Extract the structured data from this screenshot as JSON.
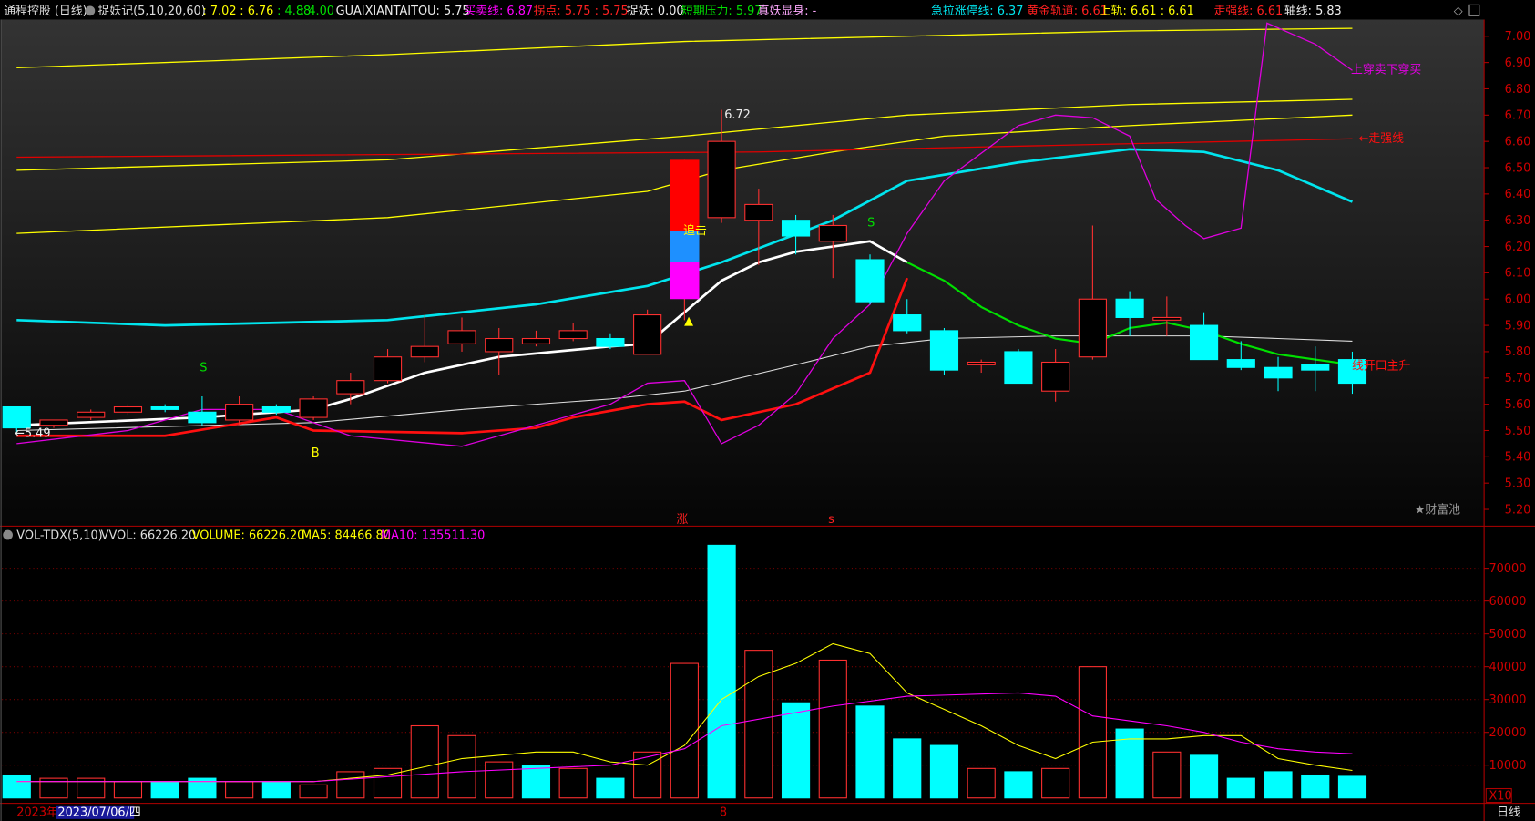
{
  "header": {
    "title": "通程控股 (日线)",
    "indicator": "捉妖记(5,10,20,60)",
    "v1": ": 7.02",
    "v2": ": 6.76",
    "v3": ": 4.88",
    "v4": ": 4.00",
    "guaixian": "GUAIXIANTAITOU: 5.75",
    "maimai": "买卖线: 6.87",
    "guaidian": "拐点: 5.75 : 5.75",
    "zhuoyao": "捉妖: 0.00",
    "duanqi": "短期压力: 5.97",
    "zhenyao": "真妖显身: -",
    "jila": "急拉涨停线: 6.37",
    "huangjin": "黄金轨道: 6.61",
    "shanggui": "上轨: 6.61 : 6.61",
    "zouqiang": "走强线: 6.61",
    "zhouxian": "轴线: 5.83"
  },
  "colors": {
    "up": "#ff3030",
    "down": "#00ffff",
    "axis": "#b00000",
    "yellow": "#ffff00",
    "magenta": "#ff00ff",
    "green": "#00e000"
  },
  "annotations": {
    "high_label": "6.72",
    "low_label": "←5.49",
    "zhuiji": "追击",
    "s1": "S",
    "s2": "S",
    "b1": "B",
    "zhang": "涨",
    "s_mark": "s",
    "shangchuan": "上穿卖下穿买",
    "zouqiangxian": "←走强线",
    "kaikou": "线开口主升",
    "caifuchi": "★财富池",
    "triangle": "▲"
  },
  "volume_header": {
    "name": "VOL-TDX(5,10)",
    "vvol": "VVOL: 66226.20",
    "volume": "VOLUME: 66226.20",
    "ma5": "MA5: 84466.80",
    "ma10": "MA10: 135511.30"
  },
  "footer": {
    "year": "2023年",
    "date": "2023/07/06/四",
    "month_mark": "8",
    "period": "日线",
    "multiplier": "X10"
  },
  "chart_data": {
    "type": "candlestick",
    "price_ticks": [
      "7.00",
      "6.90",
      "6.80",
      "6.70",
      "6.60",
      "6.50",
      "6.40",
      "6.30",
      "6.20",
      "6.10",
      "6.00",
      "5.90",
      "5.80",
      "5.70",
      "5.60",
      "5.50",
      "5.40",
      "5.30",
      "5.20"
    ],
    "ylim": [
      5.13,
      7.05
    ],
    "volume_ticks": [
      "70000",
      "60000",
      "50000",
      "40000",
      "30000",
      "20000",
      "10000"
    ],
    "candles": [
      [
        5.59,
        5.59,
        5.49,
        5.51
      ],
      [
        5.52,
        5.54,
        5.51,
        5.54
      ],
      [
        5.55,
        5.58,
        5.54,
        5.57
      ],
      [
        5.57,
        5.6,
        5.56,
        5.59
      ],
      [
        5.59,
        5.6,
        5.57,
        5.58
      ],
      [
        5.57,
        5.63,
        5.52,
        5.53
      ],
      [
        5.54,
        5.63,
        5.52,
        5.6
      ],
      [
        5.59,
        5.6,
        5.56,
        5.57
      ],
      [
        5.55,
        5.63,
        5.54,
        5.62
      ],
      [
        5.64,
        5.72,
        5.6,
        5.69
      ],
      [
        5.69,
        5.81,
        5.68,
        5.78
      ],
      [
        5.78,
        5.94,
        5.76,
        5.82
      ],
      [
        5.83,
        5.93,
        5.8,
        5.88
      ],
      [
        5.8,
        5.89,
        5.71,
        5.85
      ],
      [
        5.83,
        5.88,
        5.82,
        5.85
      ],
      [
        5.85,
        5.91,
        5.84,
        5.88
      ],
      [
        5.85,
        5.87,
        5.81,
        5.82
      ],
      [
        5.79,
        5.96,
        5.79,
        5.94
      ],
      [
        6.0,
        6.53,
        5.92,
        6.53
      ],
      [
        6.31,
        6.72,
        6.29,
        6.6
      ],
      [
        6.3,
        6.42,
        6.13,
        6.36
      ],
      [
        6.3,
        6.32,
        6.17,
        6.24
      ],
      [
        6.22,
        6.32,
        6.08,
        6.28
      ],
      [
        6.15,
        6.17,
        5.98,
        5.99
      ],
      [
        5.94,
        6.0,
        5.87,
        5.88
      ],
      [
        5.88,
        5.89,
        5.71,
        5.73
      ],
      [
        5.75,
        5.77,
        5.72,
        5.76
      ],
      [
        5.8,
        5.81,
        5.68,
        5.68
      ],
      [
        5.65,
        5.81,
        5.61,
        5.76
      ],
      [
        5.78,
        6.28,
        5.77,
        6.0
      ],
      [
        6.0,
        6.03,
        5.86,
        5.93
      ],
      [
        5.92,
        6.01,
        5.86,
        5.93
      ],
      [
        5.9,
        5.95,
        5.77,
        5.77
      ],
      [
        5.77,
        5.84,
        5.73,
        5.74
      ],
      [
        5.74,
        5.78,
        5.65,
        5.7
      ],
      [
        5.75,
        5.82,
        5.65,
        5.73
      ],
      [
        5.77,
        5.8,
        5.64,
        5.68
      ]
    ],
    "volumes": [
      7000,
      6000,
      6000,
      5000,
      5000,
      6000,
      5000,
      5000,
      4000,
      8000,
      9000,
      22000,
      19000,
      11000,
      10000,
      9000,
      6000,
      14000,
      41000,
      77000,
      45000,
      29000,
      42000,
      28000,
      18000,
      16000,
      9000,
      8000,
      9000,
      40000,
      21000,
      14000,
      13000,
      6000,
      8000,
      7000,
      6600
    ],
    "volume_up": [
      false,
      true,
      true,
      true,
      false,
      false,
      true,
      false,
      true,
      true,
      true,
      true,
      true,
      true,
      false,
      true,
      false,
      true,
      true,
      false,
      true,
      false,
      true,
      false,
      false,
      false,
      true,
      false,
      true,
      true,
      false,
      true,
      false,
      false,
      false,
      false,
      false
    ],
    "lines": [
      {
        "name": "upper-band",
        "color": "#ffff00",
        "pts": [
          [
            0,
            6.88
          ],
          [
            10,
            6.93
          ],
          [
            18,
            6.98
          ],
          [
            24,
            7.0
          ],
          [
            30,
            7.02
          ],
          [
            36,
            7.03
          ]
        ]
      },
      {
        "name": "middle-band",
        "color": "#ffff00",
        "pts": [
          [
            0,
            6.49
          ],
          [
            10,
            6.53
          ],
          [
            18,
            6.62
          ],
          [
            24,
            6.7
          ],
          [
            30,
            6.74
          ],
          [
            36,
            6.76
          ]
        ]
      },
      {
        "name": "lower-band",
        "color": "#ffff00",
        "pts": [
          [
            0,
            6.25
          ],
          [
            10,
            6.31
          ],
          [
            17,
            6.41
          ],
          [
            19,
            6.49
          ],
          [
            22,
            6.56
          ],
          [
            25,
            6.62
          ],
          [
            30,
            6.66
          ],
          [
            36,
            6.7
          ]
        ]
      },
      {
        "name": "zouqiang-line",
        "color": "#e00000",
        "pts": [
          [
            0,
            6.54
          ],
          [
            20,
            6.56
          ],
          [
            36,
            6.61
          ]
        ]
      },
      {
        "name": "jila-line",
        "color": "#00e5ee",
        "width": 2.5,
        "pts": [
          [
            0,
            5.92
          ],
          [
            4,
            5.9
          ],
          [
            10,
            5.92
          ],
          [
            14,
            5.98
          ],
          [
            17,
            6.05
          ],
          [
            19,
            6.14
          ],
          [
            22,
            6.3
          ],
          [
            24,
            6.45
          ],
          [
            27,
            6.52
          ],
          [
            30,
            6.57
          ],
          [
            32,
            6.56
          ],
          [
            34,
            6.49
          ],
          [
            36,
            6.37
          ]
        ]
      },
      {
        "name": "axis-line",
        "color": "#dddddd",
        "width": 1,
        "pts": [
          [
            0,
            5.5
          ],
          [
            8,
            5.53
          ],
          [
            12,
            5.58
          ],
          [
            16,
            5.62
          ],
          [
            18,
            5.65
          ],
          [
            21,
            5.75
          ],
          [
            23,
            5.82
          ],
          [
            25,
            5.85
          ],
          [
            28,
            5.86
          ],
          [
            32,
            5.86
          ],
          [
            34,
            5.85
          ],
          [
            36,
            5.84
          ]
        ]
      },
      {
        "name": "ma5-white",
        "color": "#ffffff",
        "width": 2.5,
        "pts": [
          [
            0,
            5.52
          ],
          [
            5,
            5.55
          ],
          [
            8,
            5.58
          ],
          [
            9,
            5.62
          ],
          [
            11,
            5.72
          ],
          [
            13,
            5.78
          ],
          [
            16,
            5.82
          ],
          [
            17,
            5.83
          ],
          [
            18,
            5.95
          ],
          [
            19,
            6.07
          ],
          [
            20,
            6.14
          ],
          [
            21,
            6.18
          ],
          [
            22,
            6.2
          ],
          [
            23,
            6.22
          ],
          [
            24,
            6.14
          ]
        ]
      },
      {
        "name": "ma5-green",
        "color": "#00e000",
        "width": 2,
        "pts": [
          [
            24,
            6.14
          ],
          [
            25,
            6.07
          ],
          [
            26,
            5.97
          ],
          [
            27,
            5.9
          ],
          [
            28,
            5.85
          ],
          [
            29,
            5.83
          ],
          [
            30,
            5.89
          ],
          [
            31,
            5.91
          ],
          [
            32,
            5.88
          ],
          [
            33,
            5.83
          ],
          [
            34,
            5.79
          ],
          [
            35,
            5.77
          ],
          [
            36,
            5.75
          ]
        ]
      },
      {
        "name": "guaidian-red",
        "color": "#ff1010",
        "width": 2.5,
        "pts": [
          [
            0,
            5.48
          ],
          [
            4,
            5.48
          ],
          [
            7,
            5.55
          ],
          [
            8,
            5.5
          ],
          [
            12,
            5.49
          ],
          [
            14,
            5.51
          ],
          [
            15,
            5.55
          ],
          [
            17,
            5.6
          ],
          [
            18,
            5.61
          ],
          [
            19,
            5.54
          ],
          [
            21,
            5.6
          ],
          [
            23,
            5.72
          ],
          [
            24,
            6.08
          ]
        ]
      },
      {
        "name": "maimai-magenta",
        "color": "#e000e0",
        "width": 1.2,
        "pts": [
          [
            0,
            5.45
          ],
          [
            3,
            5.5
          ],
          [
            5,
            5.58
          ],
          [
            7,
            5.58
          ],
          [
            9,
            5.48
          ],
          [
            12,
            5.44
          ],
          [
            14,
            5.52
          ],
          [
            16,
            5.6
          ],
          [
            17,
            5.68
          ],
          [
            18,
            5.69
          ],
          [
            19,
            5.45
          ],
          [
            20,
            5.52
          ],
          [
            21,
            5.64
          ],
          [
            22,
            5.85
          ],
          [
            23,
            5.98
          ],
          [
            24,
            6.25
          ],
          [
            25,
            6.45
          ],
          [
            27,
            6.66
          ],
          [
            28,
            6.7
          ],
          [
            29,
            6.69
          ],
          [
            30,
            6.62
          ],
          [
            30.7,
            6.38
          ],
          [
            31.5,
            6.28
          ],
          [
            32,
            6.23
          ],
          [
            33,
            6.27
          ],
          [
            33.7,
            7.05
          ],
          [
            35,
            6.97
          ],
          [
            36,
            6.87
          ]
        ]
      }
    ],
    "volume_lines": [
      {
        "name": "vol-ma5",
        "color": "#ffff00",
        "pts": [
          [
            0,
            5000
          ],
          [
            8,
            5000
          ],
          [
            10,
            7000
          ],
          [
            12,
            12000
          ],
          [
            14,
            14000
          ],
          [
            15,
            14000
          ],
          [
            16,
            11000
          ],
          [
            17,
            10000
          ],
          [
            18,
            16000
          ],
          [
            19,
            30000
          ],
          [
            20,
            37000
          ],
          [
            21,
            41000
          ],
          [
            22,
            47000
          ],
          [
            23,
            44000
          ],
          [
            24,
            32000
          ],
          [
            25,
            27000
          ],
          [
            26,
            22000
          ],
          [
            27,
            16000
          ],
          [
            28,
            12000
          ],
          [
            29,
            17000
          ],
          [
            30,
            18000
          ],
          [
            31,
            18000
          ],
          [
            32,
            19000
          ],
          [
            33,
            19000
          ],
          [
            34,
            12000
          ],
          [
            35,
            10000
          ],
          [
            36,
            8400
          ]
        ]
      },
      {
        "name": "vol-ma10",
        "color": "#ff00ff",
        "pts": [
          [
            0,
            5000
          ],
          [
            8,
            5000
          ],
          [
            12,
            8000
          ],
          [
            16,
            10000
          ],
          [
            18,
            15000
          ],
          [
            19,
            22000
          ],
          [
            21,
            26000
          ],
          [
            22,
            28000
          ],
          [
            24,
            31000
          ],
          [
            27,
            32000
          ],
          [
            28,
            31000
          ],
          [
            29,
            25000
          ],
          [
            31,
            22000
          ],
          [
            32,
            20000
          ],
          [
            33,
            17000
          ],
          [
            34,
            15000
          ],
          [
            35,
            14000
          ],
          [
            36,
            13500
          ]
        ]
      }
    ]
  }
}
